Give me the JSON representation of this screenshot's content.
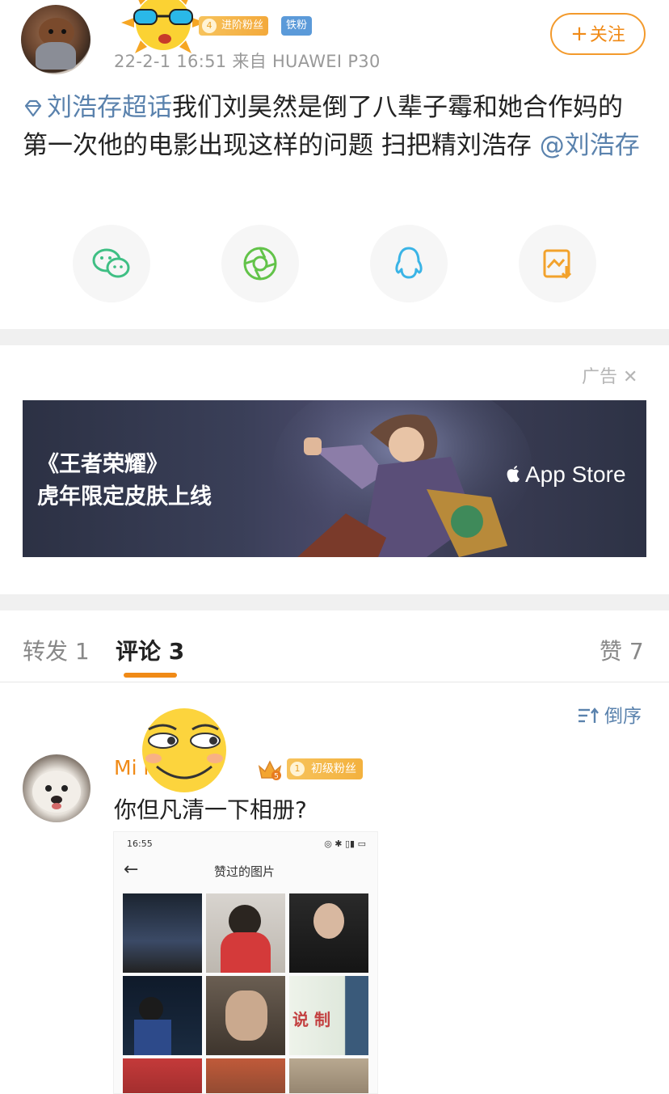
{
  "post": {
    "username": "",
    "fan_badge_level": "4",
    "fan_badge": "进阶粉丝",
    "iron_badge": "铁粉",
    "meta": "22-2-1 16:51  来自 HUAWEI P30",
    "follow": "关注",
    "follow_plus": "+",
    "topic": "刘浩存超话",
    "body": "我们刘昊然是倒了八辈子霉和她合作妈的 第一次他的电影出现这样的问题 扫把精刘浩存 ",
    "mention": "@刘浩存"
  },
  "share": {
    "icons": [
      "wechat-icon",
      "moments-icon",
      "qq-icon",
      "save-image-icon"
    ]
  },
  "ad": {
    "label": "广告",
    "close": "✕",
    "title_line1": "《王者荣耀》",
    "title_line2": "虎年限定皮肤上线",
    "store": "App Store"
  },
  "tabs": {
    "repost": "转发 1",
    "comment": "评论 3",
    "like": "赞 7"
  },
  "sort": {
    "label": "倒序"
  },
  "comment": {
    "name": "Mi          ms",
    "crown_level": "5",
    "fan_badge_level": "1",
    "fan_badge": "初级粉丝",
    "text": "你但凡清一下相册?",
    "screenshot": {
      "time": "16:55",
      "status_right": "◎ ✱ ▯▮ ▭",
      "back": "←",
      "title": "赞过的图片",
      "thumb_text": "说 制"
    }
  },
  "colors": {
    "accent": "#f08a16",
    "link": "#5a82ad",
    "divider": "#f0f0f0"
  }
}
